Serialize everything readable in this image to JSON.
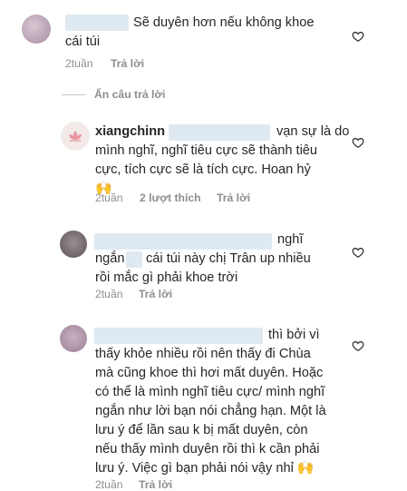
{
  "comments": [
    {
      "lines": [
        "Sẽ duyên hơn nếu không khoe",
        "cái túi"
      ],
      "time": "2tuần",
      "reply": "Trả lời"
    },
    {
      "username": "xiangchinn",
      "lines": [
        "vạn sự là do",
        "mình nghĩ, nghĩ tiêu cực sẽ thành tiêu",
        "cực, tích cực sẽ là tích cực. Hoan hỷ"
      ],
      "emoji": "🙌",
      "time": "2tuần",
      "likes": "2 lượt thích",
      "reply": "Trả lời"
    },
    {
      "lines": [
        "nghĩ",
        "ngắn",
        "cái túi này chị Trân up nhiều",
        "rồi mắc gì phải khoe trời"
      ],
      "time": "2tuần",
      "reply": "Trả lời"
    },
    {
      "lines": [
        "thì bởi vì",
        "thấy khỏe nhiều rồi nên thấy đi Chùa",
        "mà cũng khoe thì hơi mất duyên. Hoặc",
        "có thể là mình nghĩ tiêu cực/ mình nghĩ",
        "ngắn như lời bạn nói chẳng hạn. Một là",
        "lưu ý để lần sau k bị mất duyên, còn",
        "nếu thấy mình duyên rồi thì k cần phải",
        "lưu ý. Việc gì bạn phải nói vậy nhỉ"
      ],
      "emoji": "🙌",
      "time": "2tuần",
      "reply": "Trả lời"
    }
  ],
  "hide_replies": "Ẩn câu trả lời",
  "icons": {
    "like": "heart-icon"
  }
}
